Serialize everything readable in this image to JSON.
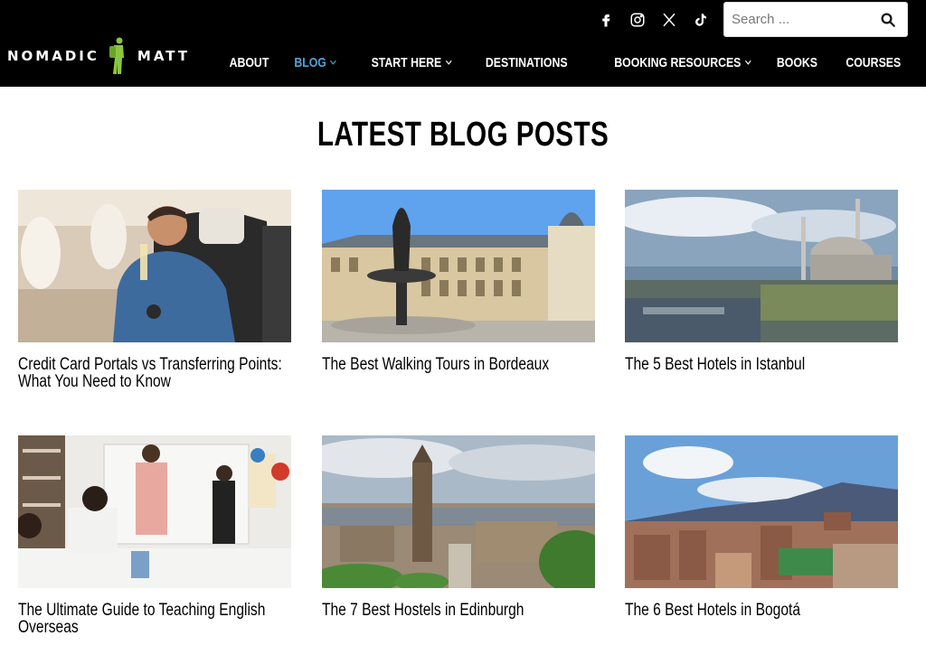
{
  "header": {
    "logo_left": "NOMADIC",
    "logo_right": "MATT",
    "socials": [
      {
        "name": "facebook"
      },
      {
        "name": "instagram"
      },
      {
        "name": "x"
      },
      {
        "name": "tiktok"
      }
    ],
    "search": {
      "placeholder": "Search ...",
      "value": ""
    },
    "nav": [
      {
        "label": "ABOUT",
        "dropdown": false,
        "active": false
      },
      {
        "label": "BLOG",
        "dropdown": true,
        "active": true
      },
      {
        "label": "START HERE",
        "dropdown": true,
        "active": false
      },
      {
        "label": "DESTINATIONS",
        "dropdown": false,
        "active": false
      },
      {
        "label": "BOOKING RESOURCES",
        "dropdown": true,
        "active": false
      },
      {
        "label": "BOOKS",
        "dropdown": false,
        "active": false
      },
      {
        "label": "COURSES",
        "dropdown": false,
        "active": false
      }
    ],
    "colors": {
      "background": "#000000",
      "active": "#4fa3d8",
      "logo_accent": "#8cc63f"
    }
  },
  "main": {
    "title": "LATEST BLOG POSTS",
    "posts": [
      {
        "title": "Credit Card Portals vs Transferring Points: What You Need to Know",
        "image": "man-on-airplane"
      },
      {
        "title": "The Best Walking Tours in Bordeaux",
        "image": "bordeaux-fountain"
      },
      {
        "title": "The 5 Best Hotels in Istanbul",
        "image": "istanbul-mosque"
      },
      {
        "title": "The Ultimate Guide to Teaching English Overseas",
        "image": "classroom"
      },
      {
        "title": "The 7 Best Hostels in Edinburgh",
        "image": "edinburgh-skyline"
      },
      {
        "title": "The 6 Best Hotels in Bogotá",
        "image": "bogota-city"
      }
    ]
  }
}
